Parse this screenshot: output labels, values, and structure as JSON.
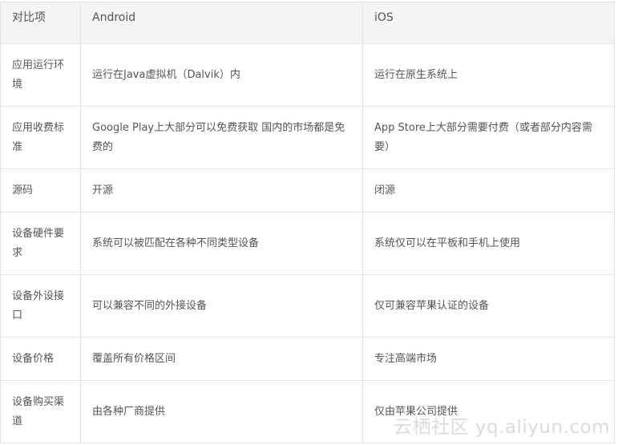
{
  "table": {
    "headers": [
      "对比项",
      "Android",
      "iOS"
    ],
    "rows": [
      {
        "item": "应用运行环境",
        "android": "运行在Java虚拟机（Dalvik）内",
        "ios": "运行在原生系统上"
      },
      {
        "item": "应用收费标准",
        "android": "Google Play上大部分可以免费获取 国内的市场都是免费的",
        "ios": "App Store上大部分需要付费（或者部分内容需要）"
      },
      {
        "item": "源码",
        "android": "开源",
        "ios": "闭源"
      },
      {
        "item": "设备硬件要求",
        "android": "系统可以被匹配在各种不同类型设备",
        "ios": "系统仅可以在平板和手机上使用"
      },
      {
        "item": "设备外设接口",
        "android": "可以兼容不同的外接设备",
        "ios": "仅可兼容苹果认证的设备"
      },
      {
        "item": "设备价格",
        "android": "覆盖所有价格区间",
        "ios": "专注高端市场"
      },
      {
        "item": "设备购买渠道",
        "android": "由各种厂商提供",
        "ios": "仅由苹果公司提供"
      }
    ]
  },
  "watermark": {
    "text": "云栖社区 yq.aliyun.com"
  }
}
